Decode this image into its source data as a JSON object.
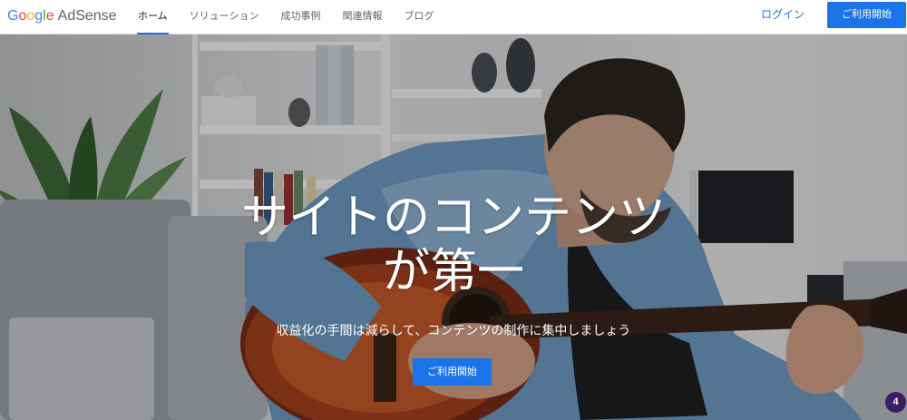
{
  "header": {
    "logo": {
      "google": [
        "G",
        "o",
        "o",
        "g",
        "l",
        "e"
      ],
      "product": "AdSense"
    },
    "nav": [
      {
        "label": "ホーム",
        "active": true
      },
      {
        "label": "ソリューション",
        "active": false
      },
      {
        "label": "成功事例",
        "active": false
      },
      {
        "label": "関連情報",
        "active": false
      },
      {
        "label": "ブログ",
        "active": false
      }
    ],
    "login": "ログイン",
    "start": "ご利用開始"
  },
  "hero": {
    "title_line1": "サイトのコンテンツ",
    "title_line2": "が第一",
    "subtitle": "収益化の手間は減らして、コンテンツの制作に集中しましょう",
    "cta": "ご利用開始"
  },
  "badge": {
    "count": "4"
  },
  "colors": {
    "accent": "#1a73e8",
    "badge": "#3c1e63"
  }
}
